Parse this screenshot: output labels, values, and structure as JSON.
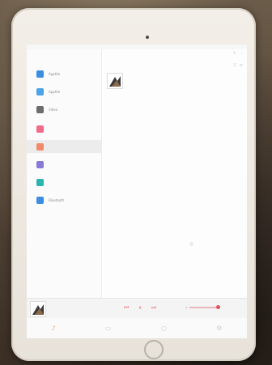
{
  "colors": {
    "accent": "#e2555e",
    "tab_active": "#f0a84c",
    "screen_bg": "#f7f7f7"
  },
  "sidebar": {
    "items": [
      {
        "label": "Apptile",
        "icon": "app-icon",
        "color": "#3d8de0"
      },
      {
        "label": "Apptile",
        "icon": "app-icon",
        "color": "#4ba4e8"
      },
      {
        "label": "Video",
        "icon": "video-icon",
        "color": "#6d6d6d"
      },
      {
        "label": "",
        "icon": "playlist-icon",
        "color": "#f06b8a"
      },
      {
        "label": "",
        "icon": "playlist-icon",
        "color": "#f08a6b"
      },
      {
        "label": "",
        "icon": "playlist-icon",
        "color": "#8a7ad8"
      },
      {
        "label": "",
        "icon": "playlist-icon",
        "color": "#2bb4b0"
      },
      {
        "label": "Bluetooth",
        "icon": "bluetooth-icon",
        "color": "#3d8de0"
      }
    ]
  },
  "tabbar": {
    "items": [
      "music-note-icon",
      "library-icon",
      "search-icon",
      "settings-icon"
    ]
  }
}
